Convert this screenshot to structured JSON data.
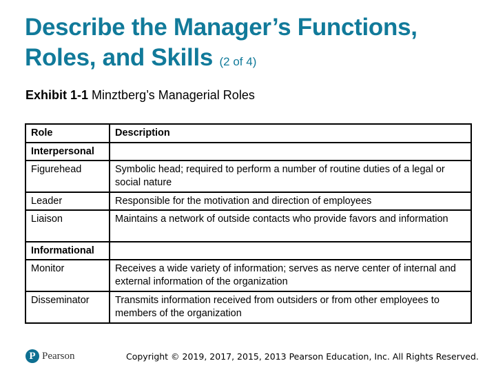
{
  "slide": {
    "title": "Describe the Manager’s Functions, Roles, and Skills",
    "title_suffix": "(2 of 4)",
    "exhibit_label": "Exhibit 1-1",
    "exhibit_title": "Minztberg’s Managerial Roles"
  },
  "table": {
    "headers": [
      "Role",
      "Description"
    ],
    "categories": [
      {
        "name": "Interpersonal",
        "rows": [
          {
            "role": "Figurehead",
            "description": "Symbolic head; required to perform a number of routine duties of a legal or social nature"
          },
          {
            "role": "Leader",
            "description": "Responsible for the motivation and direction of employees"
          },
          {
            "role": "Liaison",
            "description": "Maintains a network of outside contacts who provide favors and information"
          }
        ]
      },
      {
        "name": "Informational",
        "rows": [
          {
            "role": "Monitor",
            "description": "Receives a wide variety of information; serves as nerve center of internal and external information of the organization"
          },
          {
            "role": "Disseminator",
            "description": "Transmits information received from outsiders or from other employees to members of the organization"
          }
        ]
      }
    ]
  },
  "footer": {
    "logo_glyph": "P",
    "logo_text": "Pearson",
    "copyright": "Copyright © 2019, 2017, 2015, 2013 Pearson Education, Inc. All Rights Reserved."
  },
  "colors": {
    "title": "#117a9a",
    "logo": "#0d6f91"
  }
}
